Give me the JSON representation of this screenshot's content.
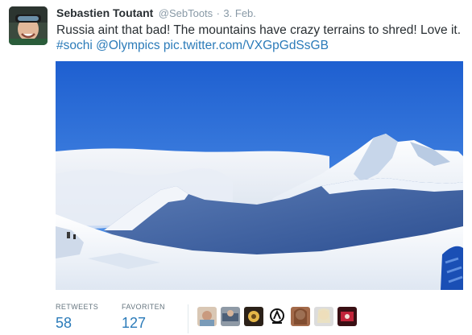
{
  "tweet": {
    "author": {
      "fullname": "Sebastien Toutant",
      "username": "@SebToots",
      "avatar_icon": "profile-photo"
    },
    "separator": "·",
    "time": "3. Feb.",
    "text_line1": "Russia aint that bad! The mountains have crazy terrains to shred! Love it.",
    "hashtag": "#sochi",
    "mention": "@Olympics",
    "pic_link": "pic.twitter.com/VXGpGdSsGB",
    "media": {
      "description_icon": "snowy-mountain-photo"
    }
  },
  "stats": {
    "retweets_label": "RETWEETS",
    "retweets_count": "58",
    "favorites_label": "FAVORITEN",
    "favorites_count": "127"
  },
  "favoriters": [
    {
      "name": "favoriter-avatar-1"
    },
    {
      "name": "favoriter-avatar-2"
    },
    {
      "name": "favoriter-avatar-3"
    },
    {
      "name": "favoriter-avatar-4"
    },
    {
      "name": "favoriter-avatar-5"
    },
    {
      "name": "favoriter-avatar-6"
    },
    {
      "name": "favoriter-avatar-7"
    }
  ],
  "colors": {
    "link": "#2b7bb9",
    "meta": "#8899a6",
    "text": "#292f33",
    "sky": "#2f6fd6"
  }
}
